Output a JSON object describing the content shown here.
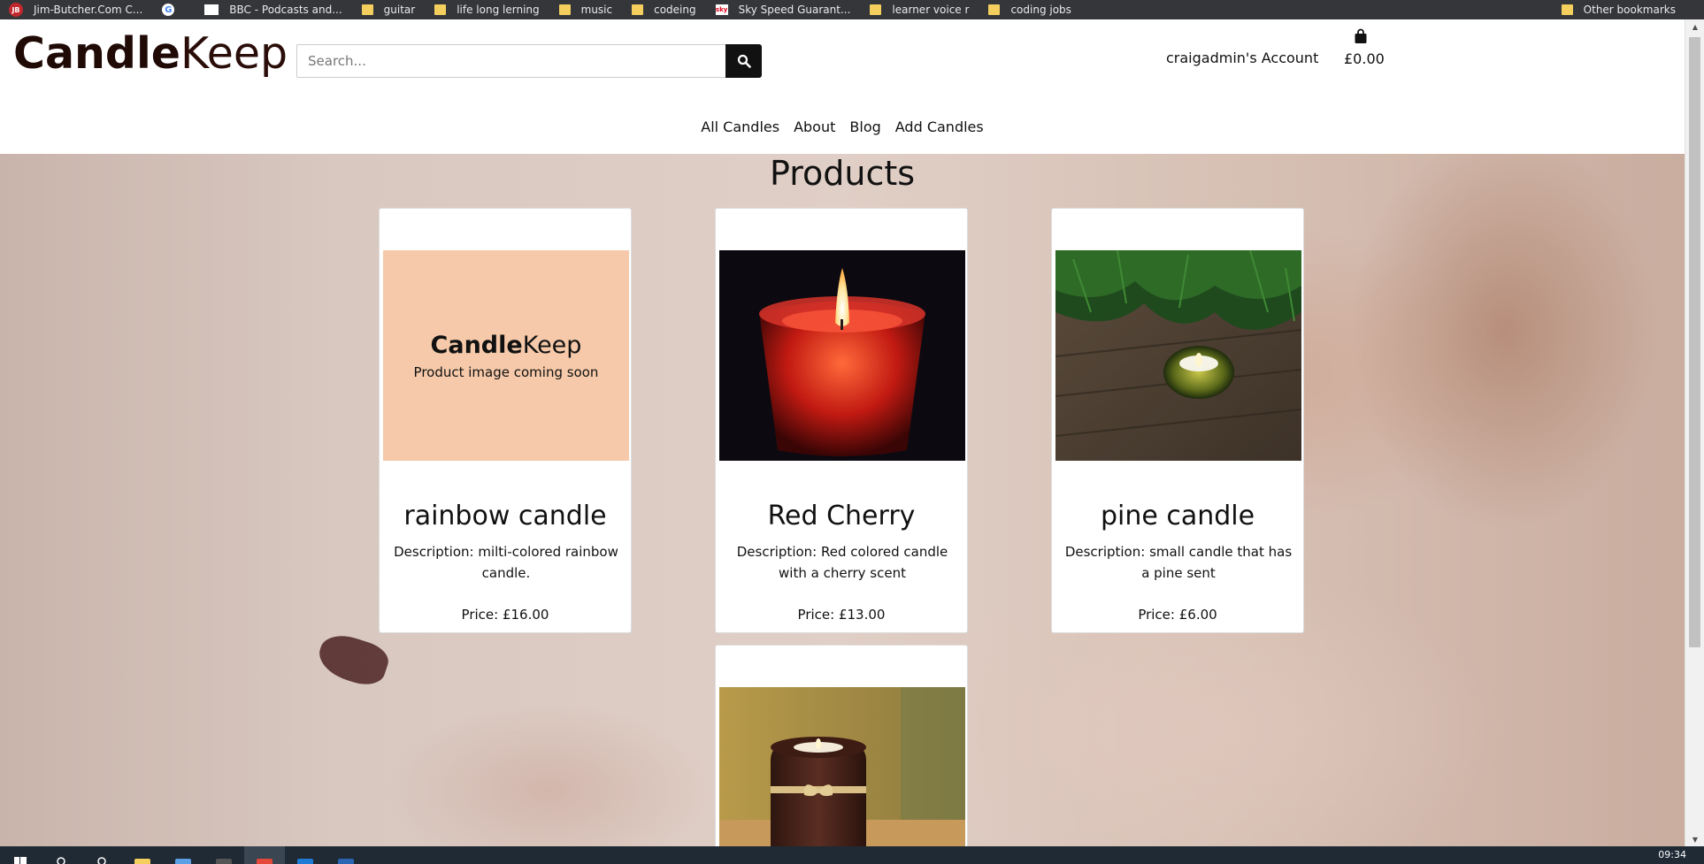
{
  "bookmarks": {
    "items": [
      {
        "label": "Jim-Butcher.Com C...",
        "icon": "jb-icon"
      },
      {
        "label": "",
        "icon": "google-icon"
      },
      {
        "label": "BBC - Podcasts and...",
        "icon": "bbc-icon"
      },
      {
        "label": "guitar",
        "icon": "folder-icon"
      },
      {
        "label": "life long lerning",
        "icon": "folder-icon"
      },
      {
        "label": "music",
        "icon": "folder-icon"
      },
      {
        "label": "codeing",
        "icon": "folder-icon"
      },
      {
        "label": "Sky Speed Guarant...",
        "icon": "sky-icon"
      },
      {
        "label": "learner voice r",
        "icon": "folder-icon"
      },
      {
        "label": "coding jobs",
        "icon": "folder-icon"
      }
    ],
    "other": "Other bookmarks"
  },
  "header": {
    "logo_bold": "Candle",
    "logo_light": "Keep",
    "search_placeholder": "Search...",
    "account": "craigadmin's Account",
    "bag_total": "£0.00"
  },
  "nav": {
    "items": [
      "All Candles",
      "About",
      "Blog",
      "Add Candles"
    ]
  },
  "main": {
    "title": "Products",
    "products": [
      {
        "name": "rainbow candle",
        "description": "Description: milti-colored rainbow candle.",
        "price": "Price: £16.00",
        "image": "placeholder",
        "placeholder_logo_bold": "Candle",
        "placeholder_logo_light": "Keep",
        "placeholder_text": "Product image coming soon"
      },
      {
        "name": "Red Cherry",
        "description": "Description: Red colored candle with a cherry scent",
        "price": "Price: £13.00",
        "image": "red-candle-photo"
      },
      {
        "name": "pine candle",
        "description": "Description: small candle that has a pine sent",
        "price": "Price: £6.00",
        "image": "pine-candle-photo"
      },
      {
        "name": "",
        "description": "",
        "price": "",
        "image": "wooden-candle-photo"
      }
    ]
  },
  "taskbar": {
    "clock": "09:34"
  },
  "colors": {
    "accent_dark": "#111111",
    "logo": "#1f0a06",
    "placeholder_bg": "#f5c9a9",
    "bookmarks_bg": "#35363a"
  }
}
